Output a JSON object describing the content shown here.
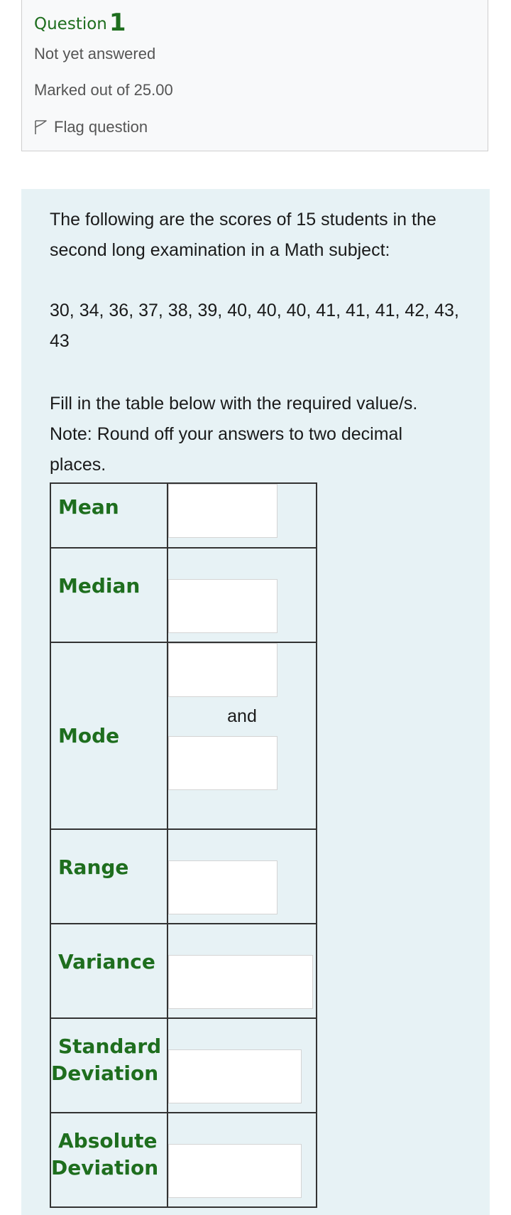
{
  "question": {
    "label": "Question",
    "number": "1",
    "state": "Not yet answered",
    "marks": "Marked out of 25.00",
    "flag_label": "Flag question"
  },
  "content": {
    "intro": "The following are the scores of 15 students in the second long examination in a Math subject:",
    "scores": "30, 34, 36, 37, 38, 39, 40, 40, 40, 41, 41, 41, 42, 43, 43",
    "instruction": "Fill in the table below with the required value/s. Note: Round off your answers to two decimal places."
  },
  "table": {
    "mean": "Mean",
    "median": "Median",
    "mode": "Mode",
    "and": "and",
    "range": "Range",
    "variance": "Variance",
    "std_line1": "Standard",
    "std_line2": "Deviation",
    "abs_line1": "Absolute",
    "abs_line2": "Deviation"
  },
  "colors": {
    "label_green": "#1e6e1e",
    "content_bg": "#e7f2f5",
    "info_bg": "#f8f9fa"
  }
}
